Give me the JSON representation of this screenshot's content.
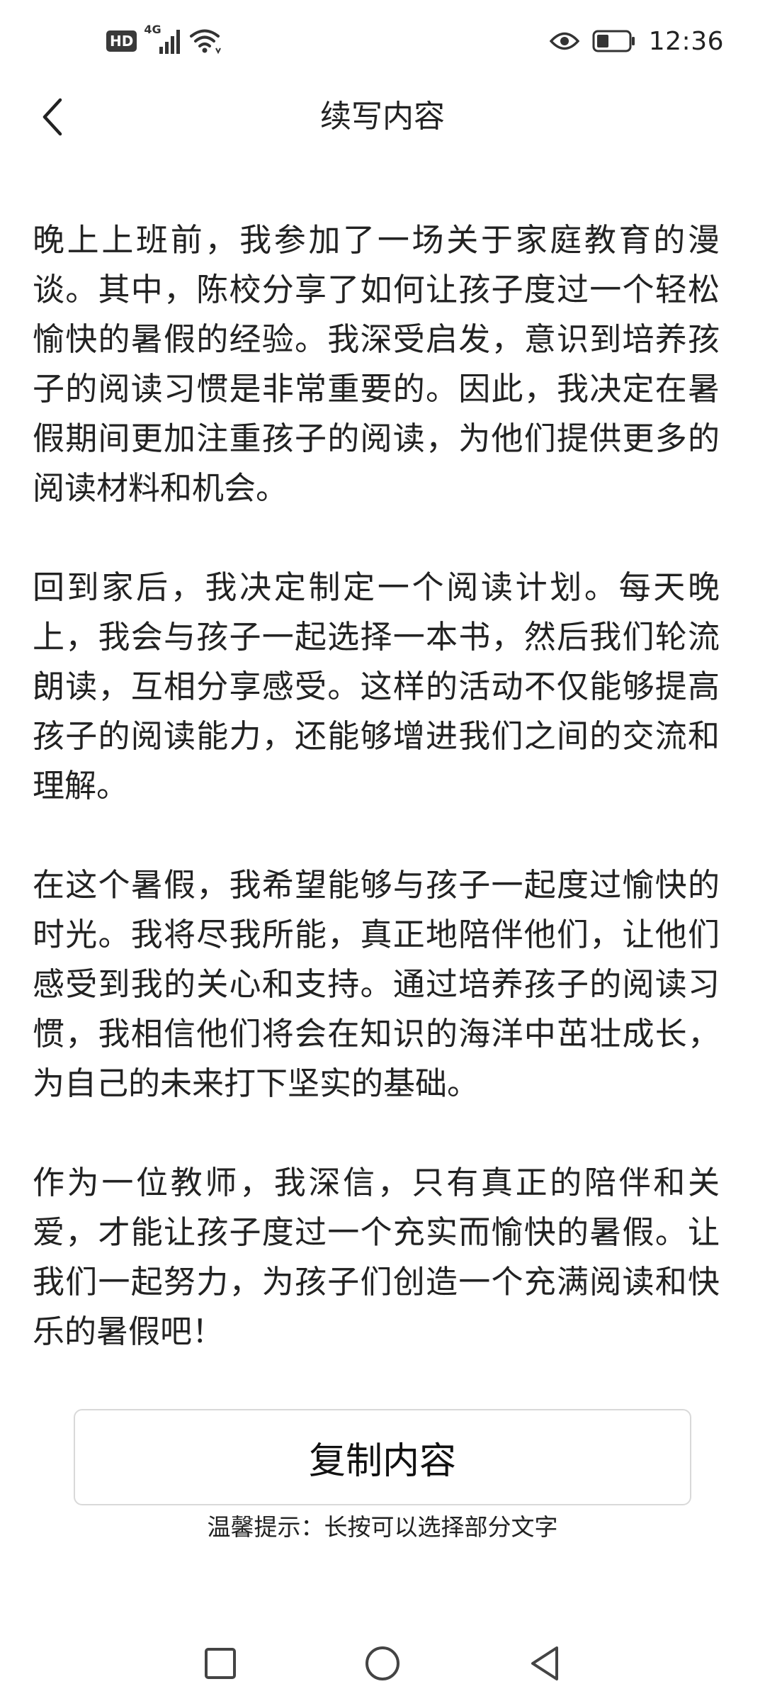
{
  "status_bar": {
    "hd_label": "HD",
    "network_label": "4G",
    "time": "12:36",
    "icons": [
      "hd-icon",
      "signal-icon",
      "wifi-icon",
      "eye-icon",
      "battery-icon"
    ]
  },
  "header": {
    "title": "续写内容",
    "back_icon": "chevron-left-icon"
  },
  "content": {
    "paragraphs": [
      "晚上上班前，我参加了一场关于家庭教育的漫谈。其中，陈校分享了如何让孩子度过一个轻松愉快的暑假的经验。我深受启发，意识到培养孩子的阅读习惯是非常重要的。因此，我决定在暑假期间更加注重孩子的阅读，为他们提供更多的阅读材料和机会。",
      "回到家后，我决定制定一个阅读计划。每天晚上，我会与孩子一起选择一本书，然后我们轮流朗读，互相分享感受。这样的活动不仅能够提高孩子的阅读能力，还能够增进我们之间的交流和理解。",
      "在这个暑假，我希望能够与孩子一起度过愉快的时光。我将尽我所能，真正地陪伴他们，让他们感受到我的关心和支持。通过培养孩子的阅读习惯，我相信他们将会在知识的海洋中茁壮成长，为自己的未来打下坚实的基础。",
      "作为一位教师，我深信，只有真正的陪伴和关爱，才能让孩子度过一个充实而愉快的暑假。让我们一起努力，为孩子们创造一个充满阅读和快乐的暑假吧！"
    ]
  },
  "actions": {
    "copy_label": "复制内容",
    "tip": "温馨提示：长按可以选择部分文字"
  },
  "nav_bar": {
    "icons": [
      "recents-square-icon",
      "home-circle-icon",
      "back-triangle-icon"
    ]
  },
  "colors": {
    "text": "#222222",
    "border": "#d9d9d9",
    "background": "#ffffff"
  }
}
